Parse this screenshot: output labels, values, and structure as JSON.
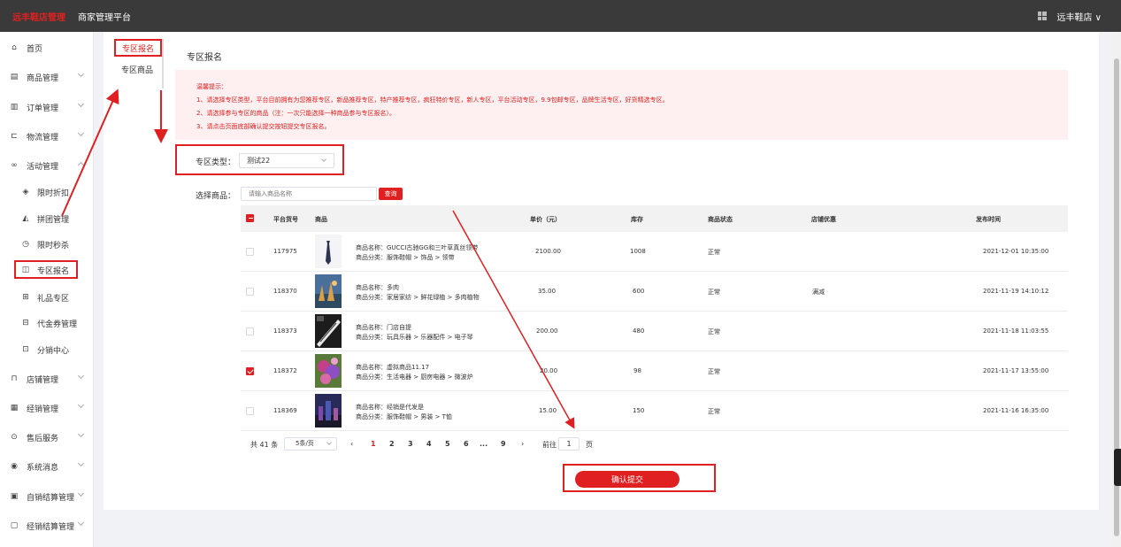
{
  "header": {
    "logo": "远丰鞋店管理",
    "platform_title": "商家管理平台",
    "shop_name": "远丰鞋店 ∨"
  },
  "sidebar": {
    "items": [
      {
        "label": "首页",
        "icon": "home-icon",
        "glyph": "⌂"
      },
      {
        "label": "商品管理",
        "icon": "goods-icon",
        "glyph": "▤"
      },
      {
        "label": "订单管理",
        "icon": "order-icon",
        "glyph": "▥"
      },
      {
        "label": "物流管理",
        "icon": "truck-icon",
        "glyph": "⊏"
      },
      {
        "label": "活动管理",
        "icon": "link-icon",
        "glyph": "∞"
      }
    ],
    "sub_items": [
      {
        "label": "限时折扣",
        "icon": "tag-icon",
        "glyph": "◈"
      },
      {
        "label": "拼团管理",
        "icon": "group-icon",
        "glyph": "◭"
      },
      {
        "label": "限时秒杀",
        "icon": "clock-icon",
        "glyph": "◷"
      },
      {
        "label": "专区报名",
        "icon": "zone-icon",
        "glyph": "◫"
      },
      {
        "label": "礼品专区",
        "icon": "gift-icon",
        "glyph": "⊞"
      },
      {
        "label": "代金券管理",
        "icon": "coupon-icon",
        "glyph": "⊟"
      },
      {
        "label": "分销中心",
        "icon": "distribution-icon",
        "glyph": "⊡"
      }
    ],
    "items_bottom": [
      {
        "label": "店铺管理",
        "icon": "store-icon",
        "glyph": "⊓"
      },
      {
        "label": "经销管理",
        "icon": "dealer-icon",
        "glyph": "▦"
      },
      {
        "label": "售后服务",
        "icon": "service-icon",
        "glyph": "⊙"
      },
      {
        "label": "系统消息",
        "icon": "message-icon",
        "glyph": "◉"
      },
      {
        "label": "自销结算管理",
        "icon": "settle-icon",
        "glyph": "▣"
      },
      {
        "label": "经销结算管理",
        "icon": "settle2-icon",
        "glyph": "▢"
      }
    ]
  },
  "tabs": {
    "active": "专区报名",
    "other": "专区商品"
  },
  "page_title": "专区报名",
  "tips": {
    "title": "温馨提示：",
    "line1": "1、请选择专区类型，平台目前拥有为您推荐专区，新品推荐专区，特产推荐专区，疯狂特价专区，新人专区，平台活动专区，9.9包邮专区，品牌生活专区，好货精选专区。",
    "line2": "2、请选择参与专区的商品（注：一次只能选择一种商品参与专区报名）。",
    "line3": "3、请点击页面底部确认提交按钮提交专区报名。"
  },
  "form": {
    "type_label": "专区类型：",
    "type_value": "测试22",
    "goods_label": "选择商品：",
    "search_placeholder": "请输入商品名称",
    "search_button": "查询"
  },
  "table": {
    "headers": {
      "sku": "平台货号",
      "goods": "商品",
      "price": "单价（元）",
      "stock": "库存",
      "status": "商品状态",
      "promo": "店铺优惠",
      "time": "发布时间"
    },
    "name_prefix": "商品名称：",
    "cat_prefix": "商品分类：",
    "rows": [
      {
        "sku": "117975",
        "name": "GUCCI古驰GG和三叶草真丝领带",
        "category": "服饰鞋帽 > 饰品 > 领带",
        "price": "2100.00",
        "stock": "1008",
        "status": "正常",
        "promo": "",
        "time": "2021-12-01 10:35:00",
        "checked": false,
        "thumb": "thumb-tie"
      },
      {
        "sku": "118370",
        "name": "多肉",
        "category": "家居家纺 > 鲜花绿植 > 多肉植物",
        "price": "35.00",
        "stock": "600",
        "status": "正常",
        "promo": "满减",
        "time": "2021-11-19 14:10:12",
        "checked": false,
        "thumb": "thumb-city"
      },
      {
        "sku": "118373",
        "name": "门店自提",
        "category": "玩具乐器 > 乐器配件 > 电子琴",
        "price": "200.00",
        "stock": "480",
        "status": "正常",
        "promo": "",
        "time": "2021-11-18 11:03:55",
        "checked": false,
        "thumb": "thumb-piano"
      },
      {
        "sku": "118372",
        "name": "虚拟商品11.17",
        "category": "生活电器 > 厨房电器 > 微波炉",
        "price": "20.00",
        "stock": "98",
        "status": "正常",
        "promo": "",
        "time": "2021-11-17 13:55:00",
        "checked": true,
        "thumb": "thumb-flower"
      },
      {
        "sku": "118369",
        "name": "经销是代发是",
        "category": "服饰鞋帽 > 男装 > T恤",
        "price": "15.00",
        "stock": "150",
        "status": "正常",
        "promo": "",
        "time": "2021-11-16 16:35:00",
        "checked": false,
        "thumb": "thumb-night"
      }
    ]
  },
  "pagination": {
    "total": "共 41 条",
    "page_size": "5条/页",
    "prev": "‹",
    "next": "›",
    "pages": [
      "1",
      "2",
      "3",
      "4",
      "5",
      "6",
      "...",
      "9"
    ],
    "current": "1",
    "goto_label": "前往",
    "goto_value": "1",
    "goto_suffix": "页"
  },
  "submit_button": "确认提交",
  "colors": {
    "accent": "#e02020",
    "topbar": "#3a3a3a",
    "tips_bg": "#fef0f0"
  }
}
